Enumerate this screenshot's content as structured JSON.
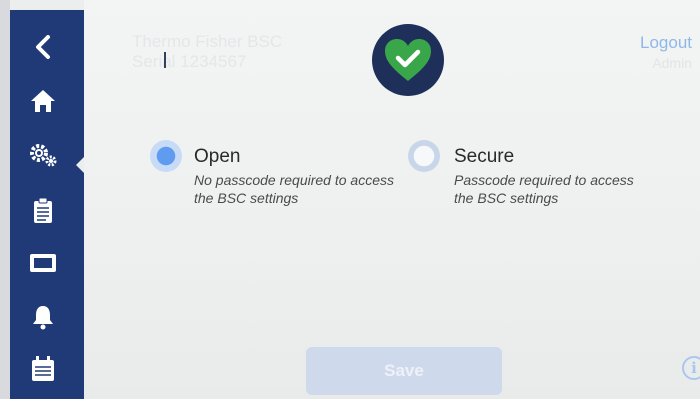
{
  "header": {
    "ghost_line1": "Thermo Fisher BSC",
    "ghost_line2": "Serial 1234567",
    "logout_label": "Logout",
    "ghost_right": "Admin"
  },
  "sidebar": {
    "items": [
      {
        "name": "back",
        "icon": "back-chevron-icon"
      },
      {
        "name": "home",
        "icon": "home-icon"
      },
      {
        "name": "settings",
        "icon": "gears-icon",
        "active": true
      },
      {
        "name": "logs",
        "icon": "clipboard-icon"
      },
      {
        "name": "display",
        "icon": "screen-icon"
      },
      {
        "name": "alarms",
        "icon": "bell-icon"
      },
      {
        "name": "calendar",
        "icon": "calendar-icon"
      }
    ]
  },
  "options": {
    "open": {
      "title": "Open",
      "desc": "No passcode required to access the BSC settings",
      "selected": true
    },
    "secure": {
      "title": "Secure",
      "desc": "Passcode required to access the BSC settings",
      "selected": false
    }
  },
  "footer": {
    "save_label": "Save",
    "info_label": "i"
  },
  "colors": {
    "sidebar": "#203a78",
    "badge": "#1e2f5a",
    "heart": "#3aa64a",
    "accent": "#5f9cf0"
  }
}
